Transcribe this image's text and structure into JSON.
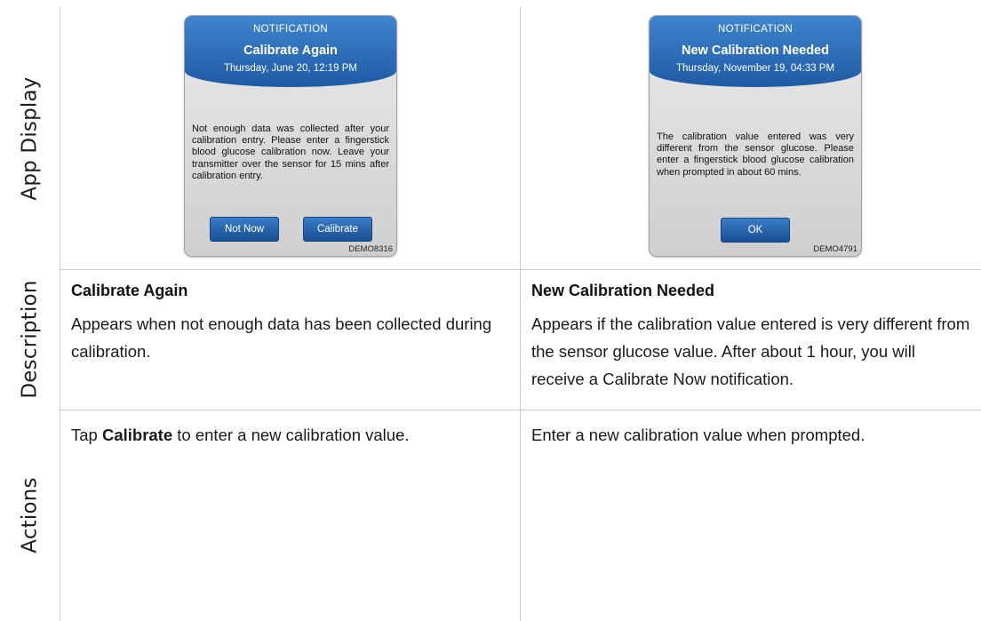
{
  "rows": {
    "app_display": "App Display",
    "description": "Description",
    "actions": "Actions"
  },
  "left": {
    "notification": {
      "kicker": "NOTIFICATION",
      "title": "Calibrate Again",
      "date": "Thursday, June 20, 12:19 PM",
      "body": "Not enough data was collected after your calibration entry. Please enter a fingerstick blood glucose calibration now. Leave your transmitter over the sensor for 15 mins after calibration entry.",
      "buttons": [
        "Not Now",
        "Calibrate"
      ],
      "code": "DEMO8316"
    },
    "description_title": "Calibrate Again",
    "description_text": "Appears when not enough data has been collected during calibration.",
    "action_prefix": "Tap ",
    "action_bold": "Calibrate",
    "action_suffix": " to enter a new calibration value."
  },
  "right": {
    "notification": {
      "kicker": "NOTIFICATION",
      "title": "New Calibration Needed",
      "date": "Thursday, November 19, 04:33 PM",
      "body": "The calibration value entered was very different from the sensor glucose. Please enter a fingerstick blood glucose calibration when prompted in about 60 mins.",
      "buttons": [
        "OK"
      ],
      "code": "DEMO4791"
    },
    "description_title": "New Calibration Needed",
    "description_text": "Appears if the calibration value entered is very different from the sensor glucose value. After about 1 hour, you will receive a Calibrate Now notification.",
    "action_text": "Enter a new calibration value when prompted."
  },
  "colors": {
    "header_blue": "#2a6bb8",
    "button_blue": "#1f5aa3",
    "grid_line": "#c9ced6"
  }
}
